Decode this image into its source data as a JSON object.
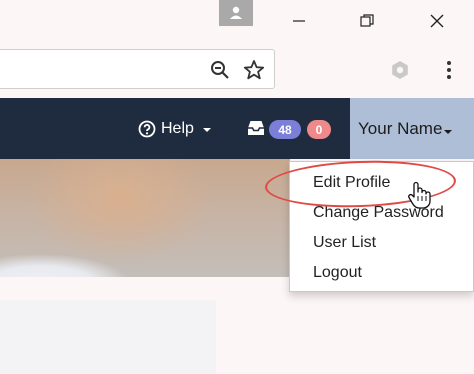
{
  "browser": {
    "window_controls": {
      "minimize_icon": "minimize-icon",
      "maximize_icon": "restore-icon",
      "close_icon": "close-icon"
    },
    "toolbar": {
      "zoom_icon": "zoom-icon",
      "bookmark_icon": "star-icon",
      "extension_icon": "extension-icon",
      "menu_icon": "kebab-menu-icon"
    }
  },
  "navbar": {
    "help_label": "Help",
    "inbox_icon": "inbox-icon",
    "badge_count_primary": "48",
    "badge_count_secondary": "0",
    "user_label": "Your Name"
  },
  "dropdown": {
    "items": [
      {
        "label": "Edit Profile"
      },
      {
        "label": "Change Password"
      },
      {
        "label": "User List"
      },
      {
        "label": "Logout"
      }
    ]
  },
  "colors": {
    "navbar_bg": "#1f2c3f",
    "user_menu_bg": "#aebed6",
    "badge_primary": "#7b7fd8",
    "badge_secondary": "#f08a8a",
    "annotation": "#e04a46"
  }
}
